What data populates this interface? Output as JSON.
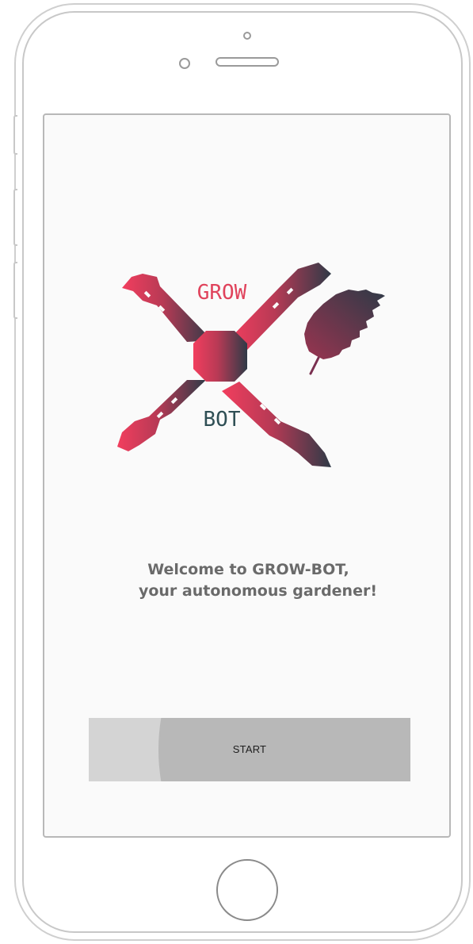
{
  "app": {
    "logo": {
      "word_top": "GROW",
      "word_bottom": "BOT",
      "colors": {
        "red": "#ef3f5c",
        "dark": "#2f3a47",
        "word_top": "#e0435c",
        "word_bottom": "#2f4f55"
      }
    },
    "welcome": {
      "line1": "Welcome to GROW-BOT,",
      "line2": "your autonomous gardener!"
    },
    "start_button": {
      "label": "START"
    }
  },
  "icons": [
    "robot-logo-icon",
    "leaf-icon"
  ]
}
